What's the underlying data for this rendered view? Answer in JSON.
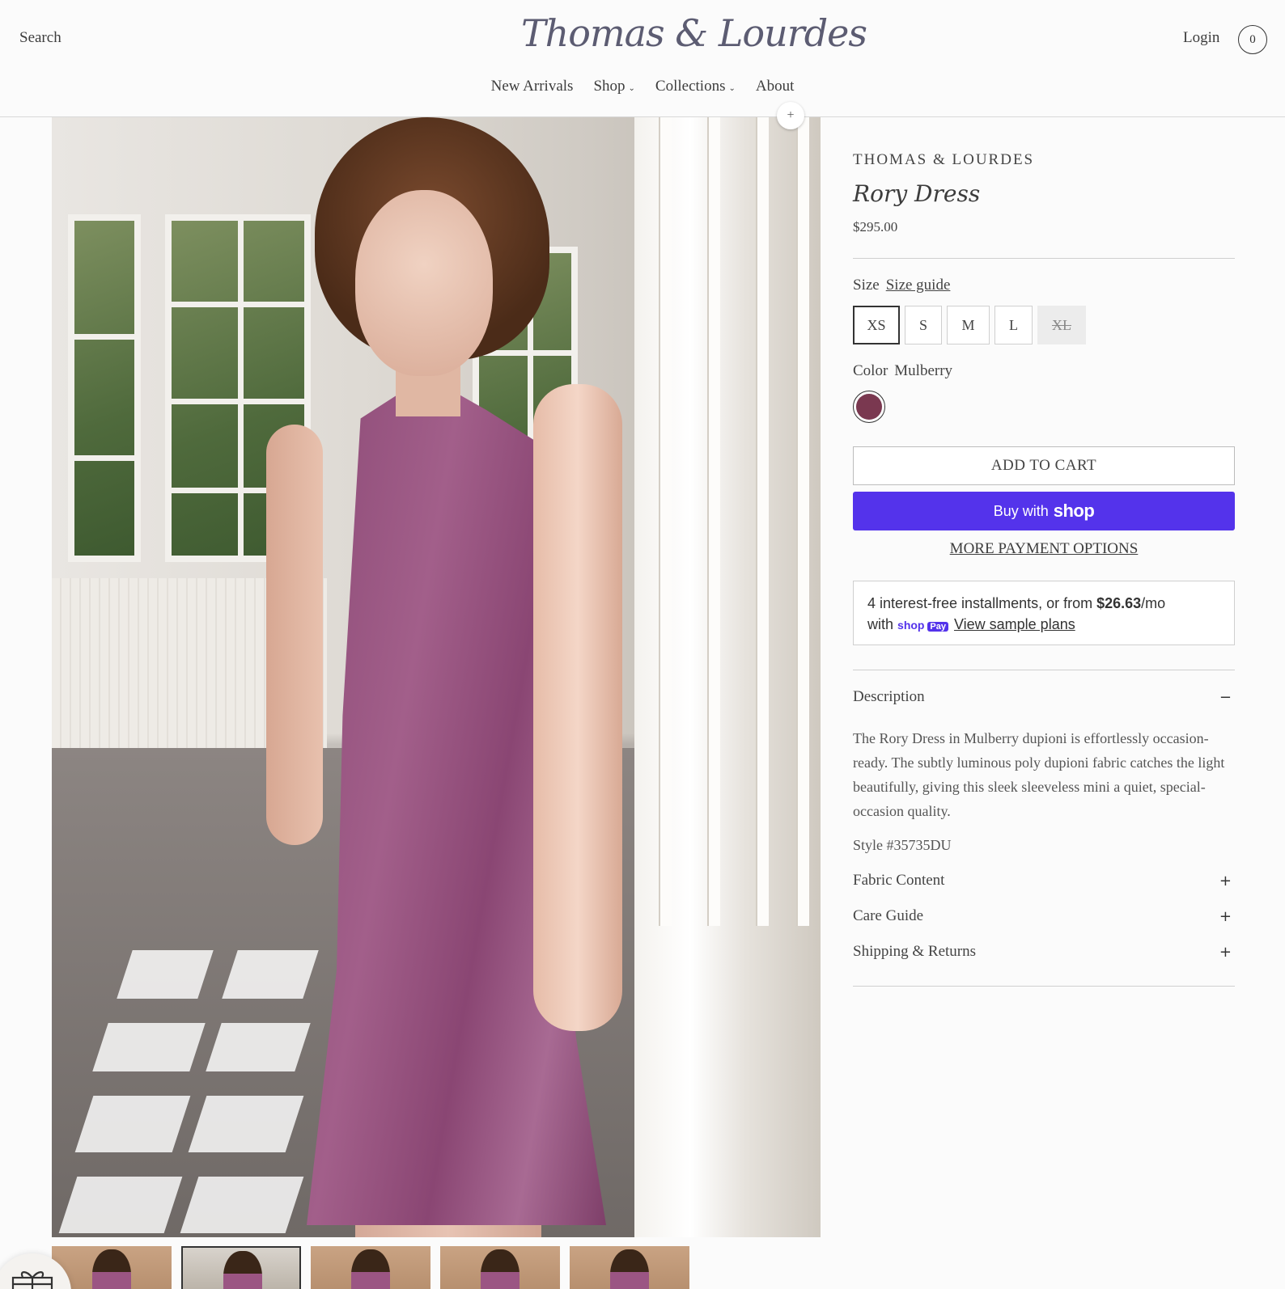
{
  "header": {
    "search_label": "Search",
    "logo_text": "Thomas & Lourdes",
    "login_label": "Login",
    "cart_count": "0",
    "nav": [
      {
        "label": "New Arrivals",
        "has_dropdown": false
      },
      {
        "label": "Shop",
        "has_dropdown": true
      },
      {
        "label": "Collections",
        "has_dropdown": true
      },
      {
        "label": "About",
        "has_dropdown": false
      }
    ]
  },
  "product": {
    "brand": "THOMAS & LOURDES",
    "title": "Rory Dress",
    "price": "$295.00",
    "size_label": "Size",
    "size_guide_label": "Size guide",
    "sizes": [
      {
        "label": "XS",
        "selected": true,
        "available": true
      },
      {
        "label": "S",
        "selected": false,
        "available": true
      },
      {
        "label": "M",
        "selected": false,
        "available": true
      },
      {
        "label": "L",
        "selected": false,
        "available": true
      },
      {
        "label": "XL",
        "selected": false,
        "available": false
      }
    ],
    "color_label": "Color",
    "color_value": "Mulberry",
    "swatch_color": "#7a3850",
    "add_to_cart_label": "ADD TO CART",
    "buy_with_label": "Buy with",
    "shop_label": "shop",
    "more_payment_label": "MORE PAYMENT OPTIONS",
    "installments": {
      "text_before": "4 interest-free installments, or from ",
      "amount": "$26.63",
      "per": "/mo",
      "with": "with",
      "shop_mini": "shop",
      "pay_mini": "Pay",
      "link": "View sample plans"
    },
    "accordion": {
      "description_label": "Description",
      "description_sign": "−",
      "description_text": "The Rory Dress in Mulberry dupioni is effortlessly occasion-ready. The subtly luminous poly dupioni fabric catches the light beautifully, giving this sleek sleeveless mini a quiet, special-occasion quality.",
      "style_number": "Style #35735DU",
      "fabric_label": "Fabric Content",
      "care_label": "Care Guide",
      "shipping_label": "Shipping & Returns",
      "plus_sign": "+"
    }
  },
  "gallery": {
    "zoom_icon": "plus-icon",
    "thumbnail_count": 5,
    "active_thumbnail": 2
  },
  "colors": {
    "accent_shop_pay": "#5433eb",
    "dress": "#9b5583"
  }
}
